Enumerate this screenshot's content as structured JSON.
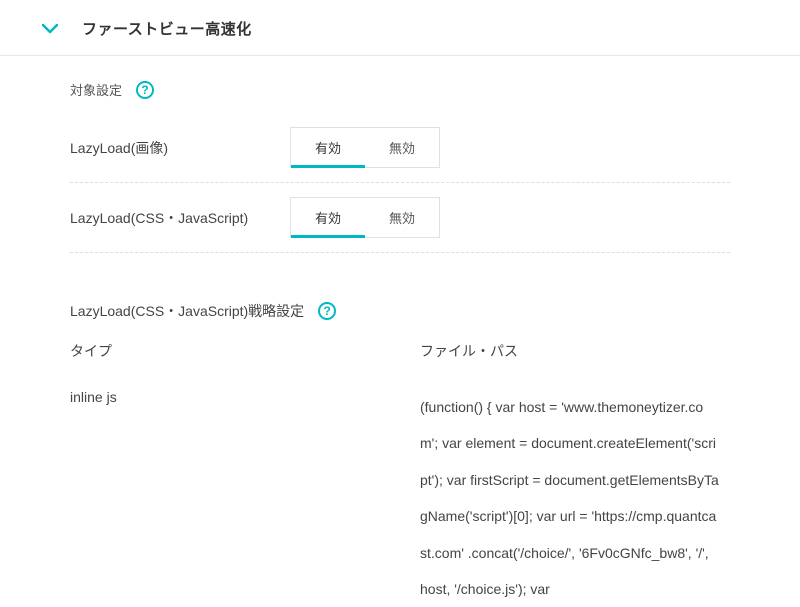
{
  "header": {
    "title": "ファーストビュー高速化"
  },
  "targetSettings": {
    "label": "対象設定",
    "rows": [
      {
        "label": "LazyLoad(画像)",
        "enabled": "有効",
        "disabled": "無効",
        "active": "enabled"
      },
      {
        "label": "LazyLoad(CSS・JavaScript)",
        "enabled": "有効",
        "disabled": "無効",
        "active": "enabled"
      }
    ]
  },
  "strategy": {
    "title": "LazyLoad(CSS・JavaScript)戦略設定",
    "columns": {
      "type": "タイプ",
      "path": "ファイル・パス"
    },
    "rows": [
      {
        "type": "inline js",
        "path": "(function() { var host = 'www.themoneytizer.com'; var element = document.createElement('script'); var firstScript = document.getElementsByTagName('script')[0]; var url = 'https://cmp.quantcast.com' .concat('/choice/', '6Fv0cGNfc_bw8', '/', host, '/choice.js'); var"
      }
    ]
  }
}
